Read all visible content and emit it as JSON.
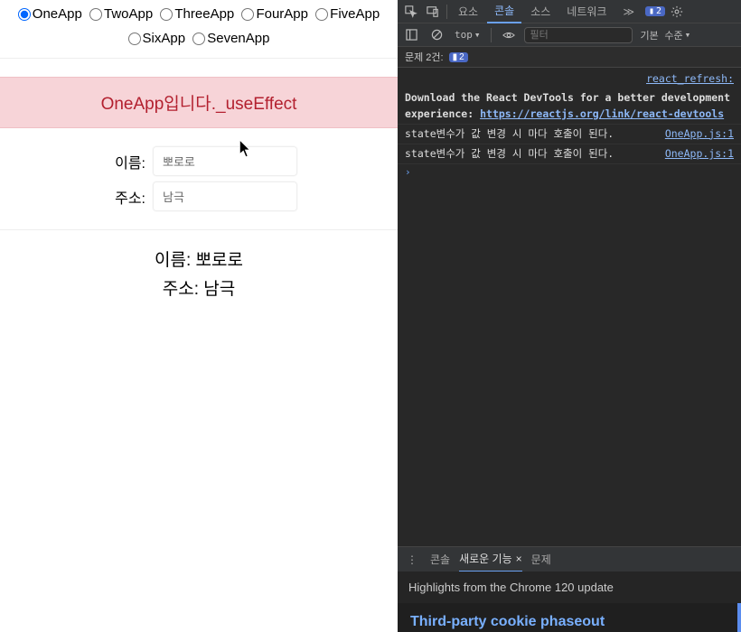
{
  "radios": {
    "selected": 0,
    "items": [
      {
        "label": "OneApp"
      },
      {
        "label": "TwoApp"
      },
      {
        "label": "ThreeApp"
      },
      {
        "label": "FourApp"
      },
      {
        "label": "FiveApp"
      },
      {
        "label": "SixApp"
      },
      {
        "label": "SevenApp"
      }
    ]
  },
  "banner": "OneApp입니다._useEffect",
  "form": {
    "name_label": "이름:",
    "name_value": "뽀로로",
    "addr_label": "주소:",
    "addr_value": "남극"
  },
  "display": {
    "name_line": "이름: 뽀로로",
    "addr_line": "주소: 남극"
  },
  "devtools": {
    "tabs": {
      "elements": "요소",
      "console": "콘솔",
      "sources": "소스",
      "network": "네트워크",
      "more": "≫"
    },
    "issues_badge": "2",
    "subbar": {
      "top": "top",
      "filter_placeholder": "필터",
      "levels": "기본 수준"
    },
    "issues_line": {
      "prefix": "문제 2건:",
      "count": "2"
    },
    "logs": {
      "refresh": "react_refresh:",
      "devtools_msg_1": "Download the React DevTools for a better development experience: ",
      "devtools_link": "https://reactjs.org/link/react-devtools",
      "state_msg": "state변수가 값 변경 시 마다 호출이 된다.",
      "source": "OneApp.js:1"
    },
    "bottom_tabs": {
      "console": "콘솔",
      "whatsnew": "새로운 기능",
      "issues": "문제"
    },
    "highlights": "Highlights from the Chrome 120 update",
    "phaseout": "Third-party cookie phaseout"
  }
}
